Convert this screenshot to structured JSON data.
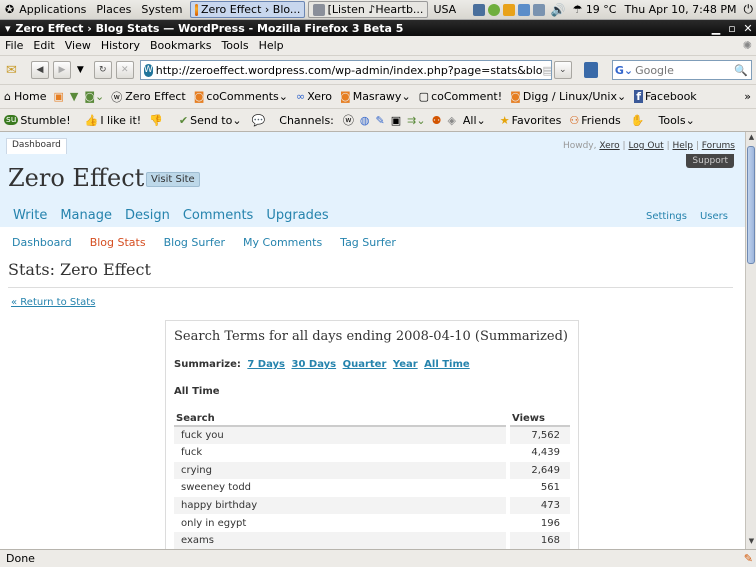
{
  "gnome_panel": {
    "menus": [
      "Applications",
      "Places",
      "System"
    ],
    "tasks": [
      {
        "label": "Zero Effect › Blo...",
        "active": true
      },
      {
        "label": "[Listen ♪Heartb...",
        "active": false
      }
    ],
    "keyboard_layout": "USA",
    "temperature": "19 °C",
    "clock": "Thu Apr 10,  7:48 PM"
  },
  "window": {
    "title": "Zero Effect › Blog Stats — WordPress - Mozilla Firefox 3 Beta 5"
  },
  "menubar": [
    "File",
    "Edit",
    "View",
    "History",
    "Bookmarks",
    "Tools",
    "Help"
  ],
  "navigation": {
    "url": "http://zeroeffect.wordpress.com/wp-admin/index.php?page=stats&blo",
    "search_placeholder": "Google"
  },
  "bookmarks": [
    "Home",
    "Zero Effect",
    "coComments",
    "Xero",
    "Masrawy",
    "coComment!",
    "Digg / Linux/Unix",
    "Facebook"
  ],
  "toolbar2": {
    "stumble": "Stumble!",
    "ilikeit": "I like it!",
    "sendto": "Send to",
    "channels": "Channels:",
    "all": "All",
    "favorites": "Favorites",
    "friends": "Friends",
    "tools": "Tools"
  },
  "wp": {
    "dashboard_tab": "Dashboard",
    "howdy": "Howdy,",
    "user": "Xero",
    "logout": "Log Out",
    "help": "Help",
    "forums": "Forums",
    "support": "Support",
    "blog_name": "Zero Effect",
    "visit_site": "Visit Site",
    "main_menu": [
      "Write",
      "Manage",
      "Design",
      "Comments",
      "Upgrades"
    ],
    "secondary_menu": [
      "Settings",
      "Users"
    ],
    "sub_menu": [
      "Dashboard",
      "Blog Stats",
      "Blog Surfer",
      "My Comments",
      "Tag Surfer"
    ],
    "current_sub": "Blog Stats",
    "page_title": "Stats: Zero Effect",
    "return_link": "« Return to Stats"
  },
  "stats_card": {
    "title": "Search Terms for all days ending 2008-04-10 (Summarized)",
    "summarize_label": "Summarize:",
    "summarize_options": [
      "7 Days",
      "30 Days",
      "Quarter",
      "Year",
      "All Time"
    ],
    "period": "All Time",
    "columns": [
      "Search",
      "Views"
    ],
    "rows": [
      {
        "term": "fuck you",
        "views": "7,562"
      },
      {
        "term": "fuck",
        "views": "4,439"
      },
      {
        "term": "crying",
        "views": "2,649"
      },
      {
        "term": "sweeney todd",
        "views": "561"
      },
      {
        "term": "happy birthday",
        "views": "473"
      },
      {
        "term": "only in egypt",
        "views": "196"
      },
      {
        "term": "exams",
        "views": "168"
      }
    ]
  },
  "status": "Done"
}
